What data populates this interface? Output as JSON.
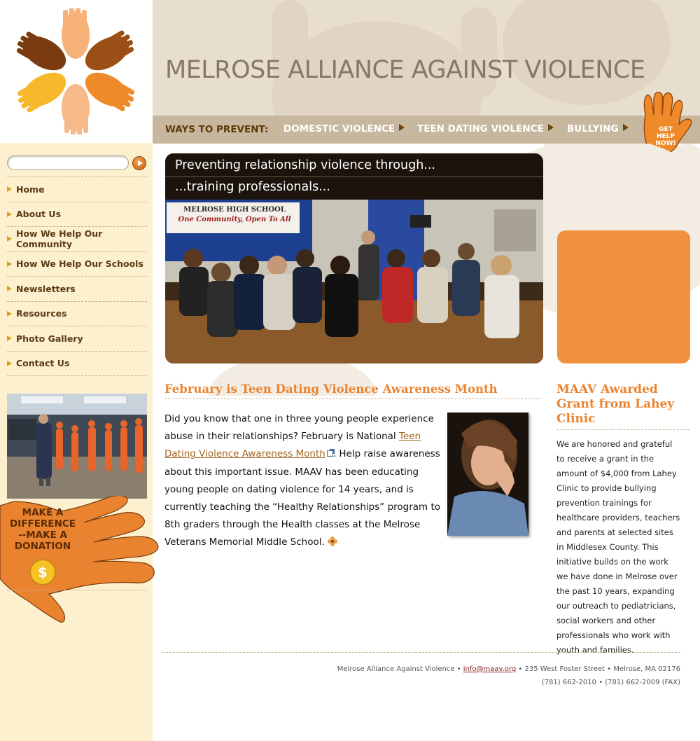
{
  "site": {
    "title": "MELROSE ALLIANCE AGAINST VIOLENCE",
    "logo_icon": "hands-circle-logo"
  },
  "prevent": {
    "label": "WAYS TO PREVENT:",
    "links": [
      "DOMESTIC VIOLENCE",
      "TEEN DATING VIOLENCE",
      "BULLYING"
    ]
  },
  "help_button": {
    "line1": "GET",
    "line2": "HELP",
    "line3": "NOW!"
  },
  "search": {
    "placeholder": "",
    "value": ""
  },
  "nav": {
    "items": [
      "Home",
      "About Us",
      "How We Help Our Community",
      "How We Help Our Schools",
      "Newsletters",
      "Resources",
      "Photo Gallery",
      "Contact Us"
    ]
  },
  "donate": {
    "line1": "MAKE A",
    "line2": "DIFFERENCE",
    "line3": "--MAKE A",
    "line4": "DONATION",
    "icon": "dollar-coin-icon"
  },
  "hero": {
    "caption1": "Preventing relationship violence through...",
    "caption2": "...training professionals...",
    "banner_line1": "MELROSE HIGH SCHOOL",
    "banner_line2": "One Community, Open To All"
  },
  "article": {
    "title": "February is Teen Dating Violence Awareness Month",
    "text1": "Did you know that one in three young people experience abuse in their relationships? February is National ",
    "link": "Teen Dating Violence Awareness Month",
    "text2": ". Help raise awareness about this important issue. MAAV has been educating young people on dating violence for 14 years, and is currently teaching the “Healthy Relationships” program to 8th graders through the Health classes at the Melrose Veterans Memorial Middle School."
  },
  "news": {
    "title": "MAAV Awarded Grant from Lahey Clinic",
    "body": "We are honored and grateful to receive a grant in the amount of $4,000 from Lahey Clinic to provide bullying prevention trainings for healthcare providers, teachers and parents at selected sites in Middlesex County. This initiative builds on the work we have done in Melrose over the past 10 years, expanding our outreach to pediatricians, social workers and other professionals who work with youth and families."
  },
  "footer": {
    "org": "Melrose Alliance Against Violence • ",
    "email": "info@maav.org",
    "address": " • 235 West Foster Street • Melrose, MA 02176",
    "phones": "(781) 662-2010 • (781) 662-2009 (FAX)"
  },
  "colors": {
    "accent_orange": "#e9832f",
    "nav_brown": "#5b3b14",
    "sidebar_bg": "#fdf0cf",
    "header_bg": "#e8ded0",
    "navbar_bg": "#c7b79e"
  }
}
